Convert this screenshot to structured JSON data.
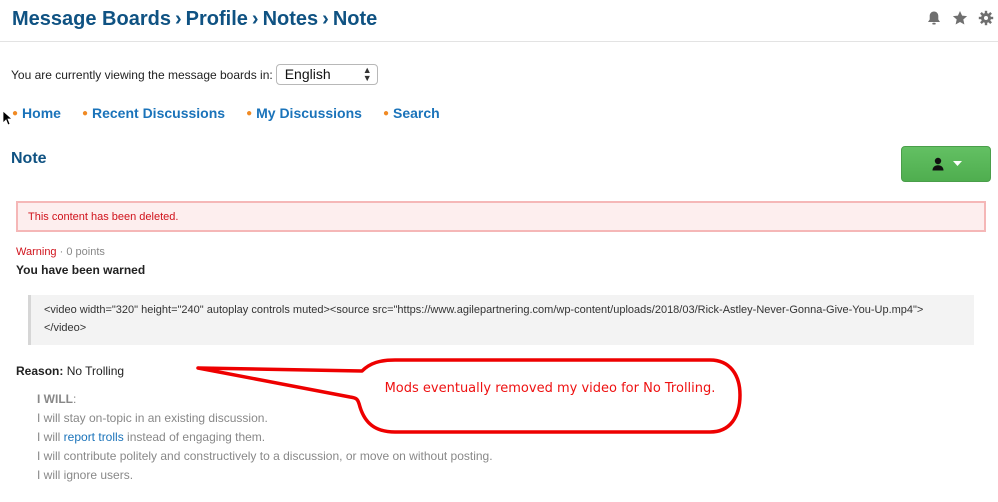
{
  "header": {
    "breadcrumb": [
      "Message Boards",
      "Profile",
      "Notes",
      "Note"
    ],
    "separator": "›",
    "icons": [
      "bell-icon",
      "star-icon",
      "gear-icon"
    ]
  },
  "language": {
    "label": "You are currently viewing the message boards in:",
    "selected": "English"
  },
  "nav": {
    "items": [
      {
        "label": "Home"
      },
      {
        "label": "Recent Discussions"
      },
      {
        "label": "My Discussions"
      },
      {
        "label": "Search"
      }
    ]
  },
  "note": {
    "title": "Note",
    "action_button_icon": "user-icon",
    "alert": "This content has been deleted.",
    "type": "Warning",
    "points_sep": " · ",
    "points": "0 points",
    "heading": "You have been warned",
    "code": "<video width=\"320\" height=\"240\" autoplay controls muted><source src=\"https://www.agilepartnering.com/wp-content/uploads/2018/03/Rick-Astley-Never-Gonna-Give-You-Up.mp4\"></video>",
    "reason_label": "Reason:",
    "reason_value": "No Trolling",
    "rules_head": "I WILL",
    "rules": {
      "line1": "I will stay on-topic in an existing discussion.",
      "line2_pre": "I will ",
      "line2_link": "report trolls",
      "line2_post": " instead of engaging them.",
      "line3": "I will contribute politely and constructively to a discussion, or move on without posting.",
      "line4": "I will ignore users."
    }
  },
  "annotation": {
    "text": "Mods eventually removed my video for No Trolling.",
    "color": "#e11111"
  }
}
